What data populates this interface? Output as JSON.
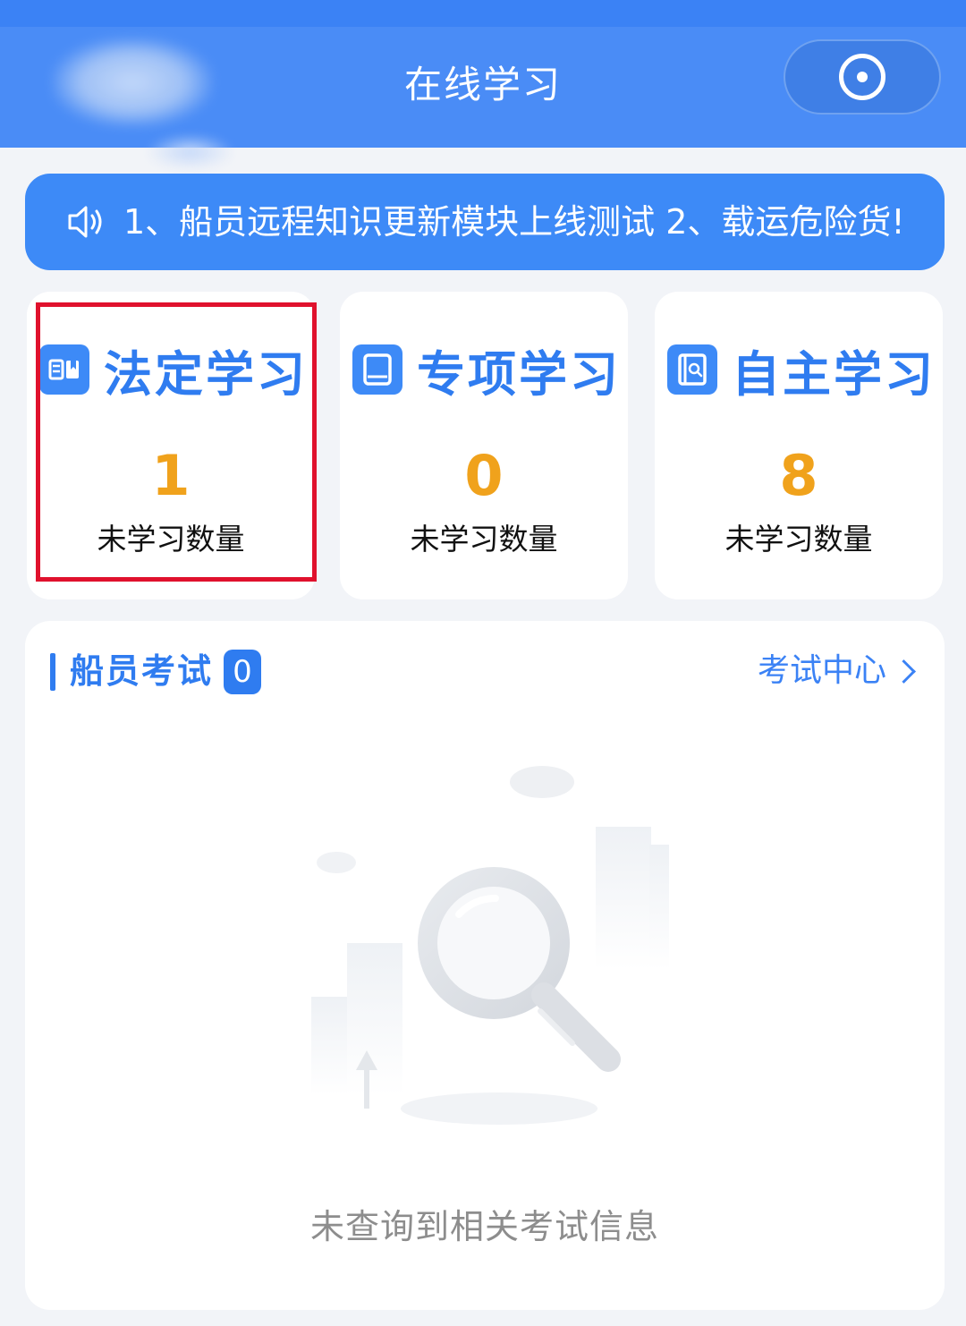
{
  "header": {
    "title": "在线学习",
    "capsule_icon": "record-target-icon"
  },
  "notice": {
    "icon": "speaker-icon",
    "text": "1、船员远程知识更新模块上线测试 2、载运危险货!"
  },
  "cards": [
    {
      "icon": "book-open-icon",
      "title": "法定学习",
      "count": "1",
      "label": "未学习数量",
      "highlighted": true
    },
    {
      "icon": "notebook-icon",
      "title": "专项学习",
      "count": "0",
      "label": "未学习数量",
      "highlighted": false
    },
    {
      "icon": "book-search-icon",
      "title": "自主学习",
      "count": "8",
      "label": "未学习数量",
      "highlighted": false
    }
  ],
  "exam": {
    "title": "船员考试",
    "badge": "0",
    "link_label": "考试中心",
    "empty_text": "未查询到相关考试信息"
  },
  "colors": {
    "header_bg": "#4a8cf6",
    "accent": "#2f7cf0",
    "count": "#f0a21c",
    "highlight_border": "#e0112d"
  }
}
